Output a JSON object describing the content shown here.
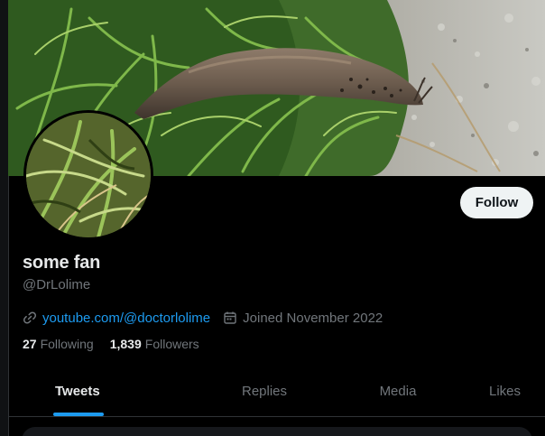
{
  "profile": {
    "display_name": "some fan",
    "handle": "@DrLolime",
    "website": "youtube.com/@doctorlolime",
    "joined": "Joined November 2022"
  },
  "actions": {
    "follow_label": "Follow"
  },
  "stats": {
    "following_count": "27",
    "following_label": "Following",
    "followers_count": "1,839",
    "followers_label": "Followers"
  },
  "tabs": [
    {
      "label": "Tweets",
      "active": true
    },
    {
      "label": "Replies",
      "active": false
    },
    {
      "label": "Media",
      "active": false
    },
    {
      "label": "Likes",
      "active": false
    }
  ],
  "icons": {
    "website": "link-icon",
    "joined": "calendar-icon"
  },
  "colors": {
    "accent": "#1d9bf0",
    "background": "#000000",
    "muted_text": "#71767b",
    "primary_text": "#e7e9ea"
  }
}
